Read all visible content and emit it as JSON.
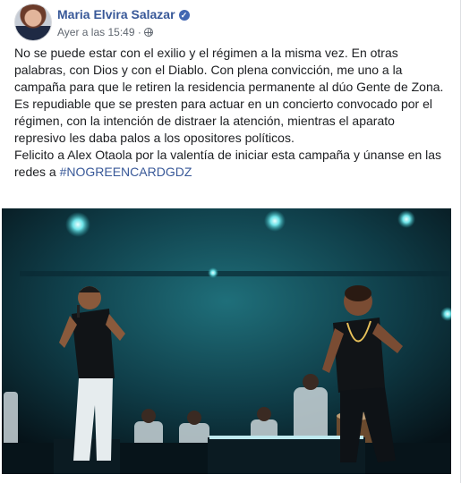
{
  "post": {
    "author": "Maria Elvira Salazar",
    "verified_icon": "verified-badge-icon",
    "timestamp": "Ayer a las 15:49",
    "separator": "·",
    "privacy_icon": "globe-icon",
    "paragraphs": [
      "No se puede estar con el exilio y el régimen a la misma vez. En otras palabras, con Dios y con el Diablo. Con plena convicción, me uno a la campaña para que le retiren la residencia permanente al dúo Gente de Zona.",
      "Es repudiable que se presten para actuar en un concierto convocado por el régimen, con la intención de distraer la atención, mientras el aparato represivo les daba palos a los opositores políticos."
    ],
    "last_paragraph_prefix": "Felicito a Alex Otaola por la valentía de iniciar esta campaña y únanse en las redes a ",
    "hashtag": "#NOGREENCARDGDZ"
  },
  "colors": {
    "link": "#385898",
    "text": "#1c1e21",
    "meta": "#606770",
    "stage_teal": "#2aa3a8"
  }
}
